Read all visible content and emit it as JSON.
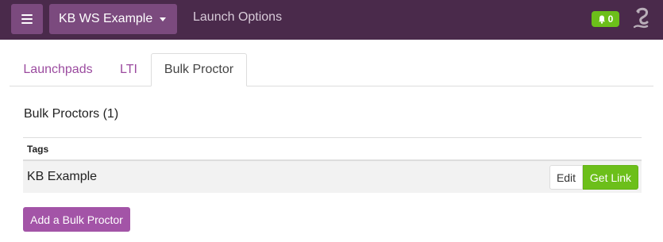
{
  "topbar": {
    "workspace_label": "KB WS Example",
    "launch_options_label": "Launch Options",
    "notification_count": "0",
    "colors": {
      "bar": "#4a2a4b",
      "button": "#7b4a7e",
      "badge": "#6cbf1a"
    }
  },
  "tabs": [
    {
      "label": "Launchpads",
      "active": false
    },
    {
      "label": "LTI",
      "active": false
    },
    {
      "label": "Bulk Proctor",
      "active": true
    }
  ],
  "main": {
    "section_title": "Bulk Proctors (1)",
    "table": {
      "header": "Tags",
      "rows": [
        {
          "tag": "KB Example",
          "edit_label": "Edit",
          "link_label": "Get Link"
        }
      ]
    },
    "add_button_label": "Add a Bulk Proctor"
  },
  "icons": [
    "menu-icon",
    "caret-down-icon",
    "bell-icon",
    "logo-icon"
  ]
}
